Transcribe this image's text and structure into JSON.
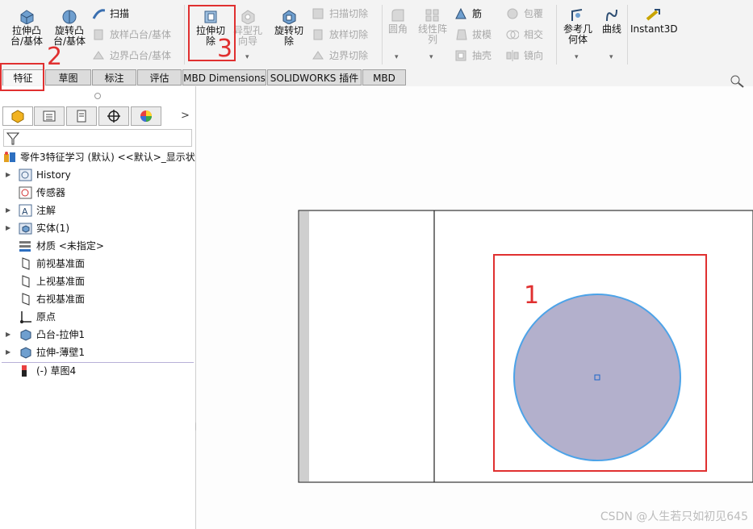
{
  "ribbon": {
    "extrude_boss": "拉伸凸\n台/基体",
    "revolve_boss": "旋转凸\n台/基体",
    "sweep": "扫描",
    "loft_boss": "放样凸台/基体",
    "boundary_boss": "边界凸台/基体",
    "extrude_cut": "拉伸切\n除",
    "hole_wizard": "异型孔\n向导",
    "revolve_cut": "旋转切\n除",
    "sweep_cut": "扫描切除",
    "loft_cut": "放样切除",
    "boundary_cut": "边界切除",
    "fillet": "圆角",
    "linear_pattern": "线性阵\n列",
    "rib": "筋",
    "draft": "拔模",
    "shell": "抽壳",
    "wrap": "包覆",
    "intersect": "相交",
    "mirror": "镜向",
    "ref_geometry": "参考几\n何体",
    "curves": "曲线",
    "instant3d": "Instant3D"
  },
  "tabs": [
    "特征",
    "草图",
    "标注",
    "评估",
    "MBD Dimensions",
    "SOLIDWORKS 插件",
    "MBD"
  ],
  "tree": {
    "root": "零件3特征学习 (默认) <<默认>_显示状",
    "items": [
      "History",
      "传感器",
      "注解",
      "实体(1)",
      "材质 <未指定>",
      "前视基准面",
      "上视基准面",
      "右视基准面",
      "原点",
      "凸台-拉伸1",
      "拉伸-薄壁1",
      "(-) 草图4"
    ]
  },
  "annotations": {
    "n1": "1",
    "n2": "2",
    "n3": "3"
  },
  "watermark": "CSDN @人生若只如初见645",
  "colors": {
    "accent_red": "#e03030",
    "circle_fill": "#b3b0cc",
    "circle_stroke": "#4da3e8"
  }
}
